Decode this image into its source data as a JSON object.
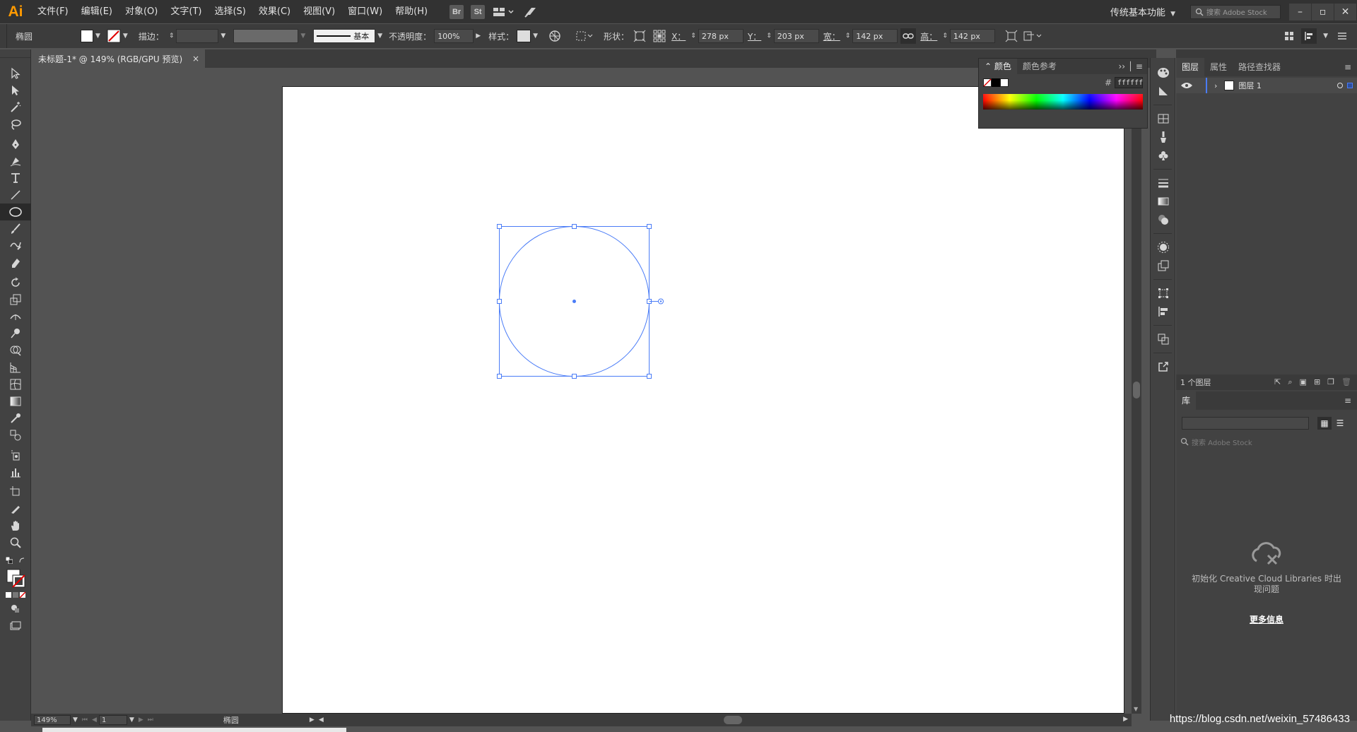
{
  "menubar": {
    "logo": "Ai",
    "items": [
      "文件(F)",
      "编辑(E)",
      "对象(O)",
      "文字(T)",
      "选择(S)",
      "效果(C)",
      "视图(V)",
      "窗口(W)",
      "帮助(H)"
    ],
    "bridge_label": "Br",
    "stock_label": "St",
    "workspace": "传统基本功能",
    "search_placeholder": "搜索 Adobe Stock"
  },
  "controlbar": {
    "object_type": "椭圆",
    "stroke_label": "描边：",
    "stroke_style": "基本",
    "opacity_label": "不透明度：",
    "opacity_value": "100%",
    "style_label": "样式：",
    "shape_label": "形状：",
    "x_label": "X：",
    "x_value": "278 px",
    "y_label": "Y：",
    "y_value": "203 px",
    "w_label": "宽：",
    "w_value": "142 px",
    "h_label": "高：",
    "h_value": "142 px"
  },
  "document": {
    "tab_title": "未标题-1* @ 149% (RGB/GPU 预览)",
    "close": "×"
  },
  "statusbar": {
    "zoom": "149%",
    "artboard": "1",
    "tool_name": "椭圆"
  },
  "color_panel": {
    "tabs": [
      "颜色",
      "颜色参考"
    ],
    "hex_prefix": "#",
    "hex_value": "ffffff"
  },
  "layers_panel": {
    "tabs": [
      "图层",
      "属性",
      "路径查找器"
    ],
    "layer_name": "图层 1",
    "layer_count": "1 个图层"
  },
  "libraries_panel": {
    "title": "库",
    "search_placeholder": "搜索 Adobe Stock",
    "message_line1": "初始化 Creative Cloud Libraries 时出",
    "message_line2": "现问题",
    "more_info": "更多信息"
  },
  "watermark": "https://blog.csdn.net/weixin_57486433",
  "colors": {
    "accent": "#4a7cf7",
    "app_bg": "#535353",
    "panel_bg": "#424242",
    "logo": "#ff9a00"
  }
}
